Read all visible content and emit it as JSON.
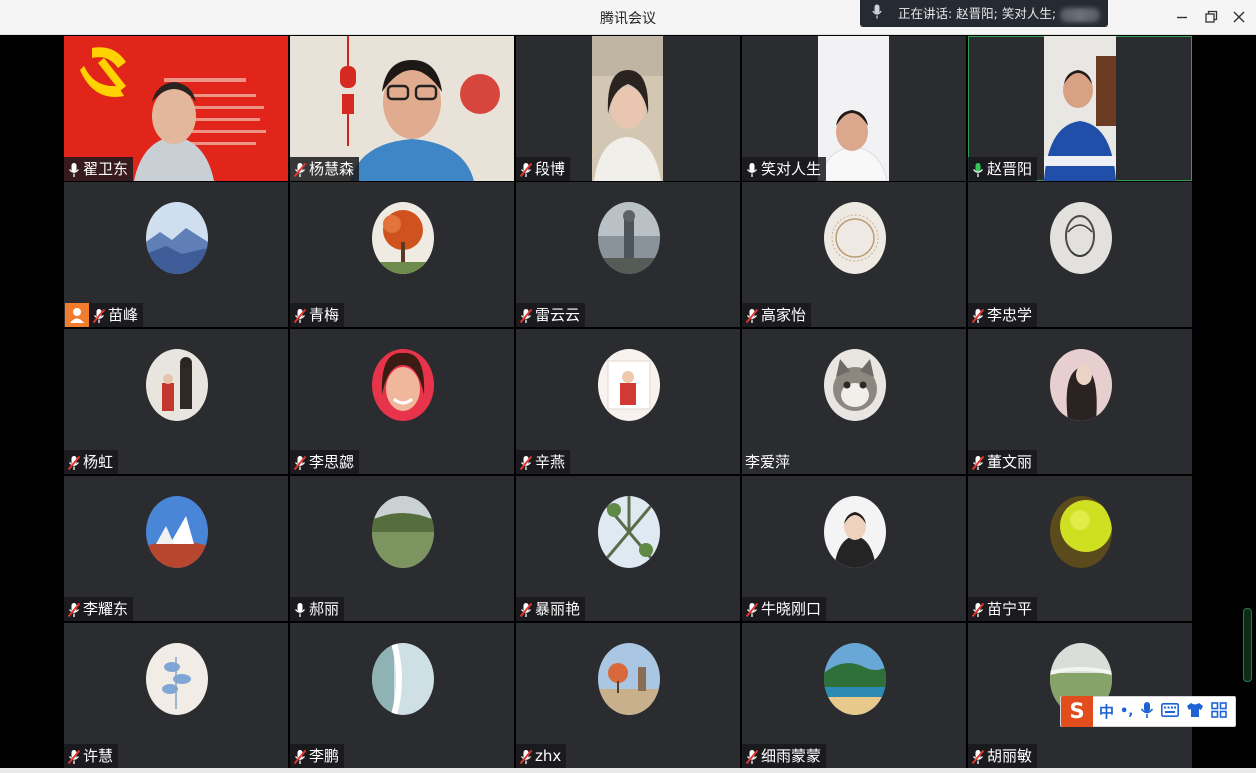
{
  "window": {
    "title": "腾讯会议",
    "speaking_label": "正在讲话: 赵晋阳; 笑对人生;"
  },
  "participants": [
    {
      "name": "翟卫东",
      "mic": "on"
    },
    {
      "name": "杨慧森",
      "mic": "muted"
    },
    {
      "name": "段博",
      "mic": "muted"
    },
    {
      "name": "笑对人生",
      "mic": "on"
    },
    {
      "name": "赵晋阳",
      "mic": "speaking"
    },
    {
      "name": "苗峰",
      "mic": "muted",
      "host": true
    },
    {
      "name": "青梅",
      "mic": "muted"
    },
    {
      "name": "雷云云",
      "mic": "muted"
    },
    {
      "name": "高家怡",
      "mic": "muted"
    },
    {
      "name": "李忠学",
      "mic": "muted"
    },
    {
      "name": "杨虹",
      "mic": "muted"
    },
    {
      "name": "李思勰",
      "mic": "muted"
    },
    {
      "name": "辛燕",
      "mic": "muted"
    },
    {
      "name": "李爱萍",
      "mic": "none"
    },
    {
      "name": "董文丽",
      "mic": "muted"
    },
    {
      "name": "李耀东",
      "mic": "muted"
    },
    {
      "name": "郝丽",
      "mic": "on"
    },
    {
      "name": "暴丽艳",
      "mic": "muted"
    },
    {
      "name": "牛晓刚口",
      "mic": "muted"
    },
    {
      "name": "苗宁平",
      "mic": "muted"
    },
    {
      "name": "许慧",
      "mic": "muted"
    },
    {
      "name": "李鹏",
      "mic": "muted"
    },
    {
      "name": "zhx",
      "mic": "muted"
    },
    {
      "name": "细雨蒙蒙",
      "mic": "muted"
    },
    {
      "name": "胡丽敏",
      "mic": "muted"
    }
  ],
  "ime_toolbar": {
    "logo": "S",
    "mode": "中",
    "punct": "•,",
    "icons": [
      "microphone-icon",
      "keyboard-icon",
      "skin-shirt-icon",
      "grid-menu-icon"
    ]
  },
  "colors": {
    "tile_bg": "#2b2c2f",
    "speaking_green": "#2e9e4e",
    "muted_red": "#e0372d",
    "host_orange": "#f07c2e",
    "ime_red": "#e24d1e"
  }
}
